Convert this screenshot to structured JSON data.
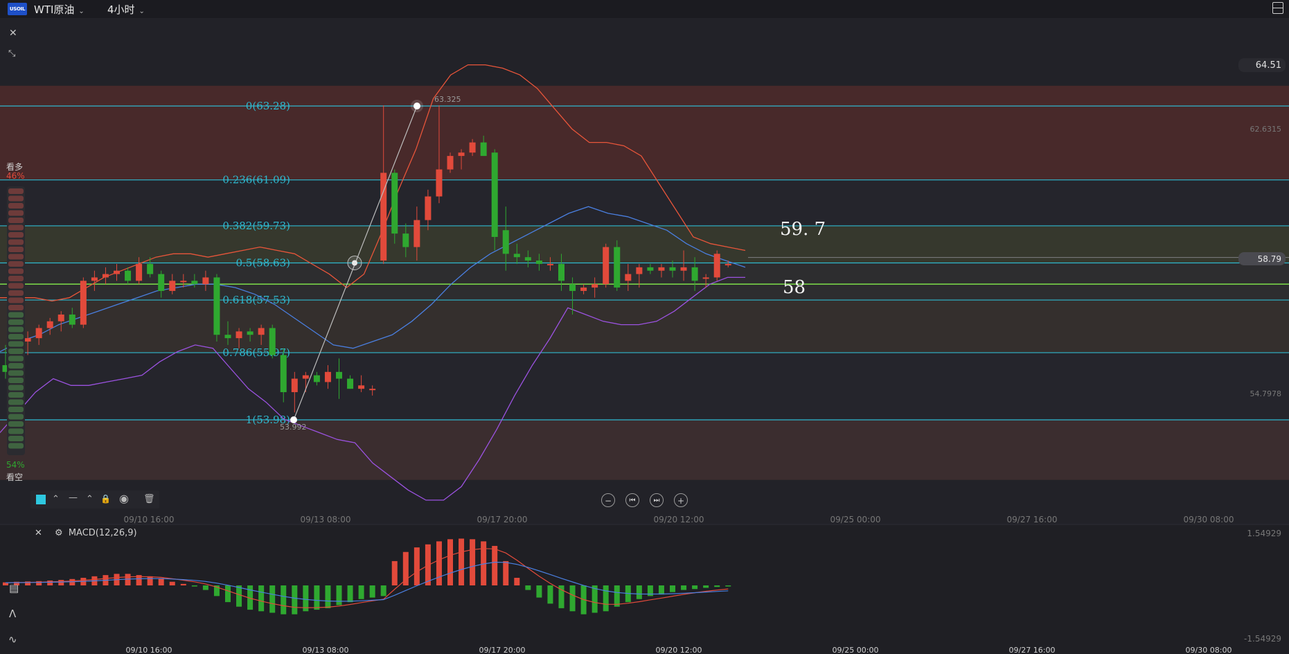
{
  "header": {
    "logo_text": "USOIL",
    "symbol_label": "WTI原油",
    "timeframe_label": "4小时",
    "chevron_icon": "chevron-down-icon",
    "layout_icon": "layout-panel-icon"
  },
  "left_tools": {
    "close_icon": "close-icon",
    "collapse_icon": "collapse-arrows-icon"
  },
  "sentiment": {
    "bull_label": "看多",
    "bull_pct": "46%",
    "bear_label": "看空",
    "bear_pct": "54%",
    "bull_fraction": 0.46
  },
  "price_axis": {
    "top": "64.51",
    "level_1": "62.6315",
    "level_2": "54.7978",
    "current": "58.79"
  },
  "fib": {
    "levels": [
      "0(63.28)",
      "0.236(61.09)",
      "0.382(59.73)",
      "0.5(58.63)",
      "0.618(57.53)",
      "0.786(55.97)",
      "1(53.98)"
    ],
    "high_label": "63.325",
    "low_label": "53.992"
  },
  "annotations": {
    "label_a": "59. 7",
    "label_b": "58"
  },
  "x_axis": {
    "ticks": [
      "09/10 16:00",
      "09/13 08:00",
      "09/17 20:00",
      "09/20 12:00",
      "09/25 00:00",
      "09/27 16:00",
      "09/30 08:00"
    ]
  },
  "drawing_toolbox": {
    "color": "#2ec8e0",
    "icons": [
      "color-swatch-icon",
      "chevron-up-icon",
      "line-style-icon",
      "chevron-up-icon",
      "lock-icon",
      "eye-icon",
      "trash-icon"
    ]
  },
  "nav_buttons": {
    "zoom_out": "−",
    "prev": "⏮",
    "next": "⏭",
    "zoom_in": "+"
  },
  "macd": {
    "label": "MACD(12,26,9)",
    "axis_top": "1.54929",
    "axis_bottom": "-1.54929"
  },
  "colors": {
    "up": "#e24a3b",
    "down": "#2fa830",
    "fib_line": "#2fb9cf",
    "horizontal": "#7ee04a",
    "boll_upper": "#e8553a",
    "boll_mid": "#4a7fe0",
    "boll_lower": "#9b52e0"
  },
  "chart_data": {
    "type": "candlestick",
    "symbol": "WTI原油",
    "interval": "4小时",
    "x_ticks": [
      "09/10 16:00",
      "09/13 08:00",
      "09/17 20:00",
      "09/20 12:00",
      "09/25 00:00",
      "09/27 16:00",
      "09/30 08:00"
    ],
    "ohlc": [
      [
        55.6,
        56.2,
        55.2,
        55.4
      ],
      [
        55.6,
        56.5,
        55.1,
        56.3
      ],
      [
        56.3,
        56.6,
        55.9,
        56.4
      ],
      [
        56.4,
        56.8,
        56.2,
        56.7
      ],
      [
        56.7,
        57.0,
        56.5,
        56.9
      ],
      [
        56.9,
        57.2,
        56.6,
        57.1
      ],
      [
        57.1,
        57.3,
        56.7,
        56.8
      ],
      [
        56.8,
        58.2,
        56.7,
        58.1
      ],
      [
        58.1,
        58.4,
        57.8,
        58.2
      ],
      [
        58.2,
        58.5,
        58.0,
        58.3
      ],
      [
        58.3,
        58.6,
        58.1,
        58.4
      ],
      [
        58.4,
        58.5,
        58.0,
        58.1
      ],
      [
        58.1,
        58.8,
        58.0,
        58.6
      ],
      [
        58.6,
        58.8,
        58.2,
        58.3
      ],
      [
        58.3,
        58.4,
        57.6,
        57.8
      ],
      [
        57.8,
        58.3,
        57.7,
        58.1
      ],
      [
        58.1,
        58.3,
        57.9,
        58.1
      ],
      [
        58.1,
        58.3,
        57.9,
        58.0
      ],
      [
        58.0,
        58.4,
        57.8,
        58.2
      ],
      [
        58.2,
        58.3,
        56.3,
        56.5
      ],
      [
        56.5,
        56.9,
        56.2,
        56.4
      ],
      [
        56.4,
        56.7,
        56.1,
        56.6
      ],
      [
        56.6,
        56.7,
        56.3,
        56.5
      ],
      [
        56.5,
        56.8,
        56.2,
        56.7
      ],
      [
        56.7,
        56.8,
        55.8,
        55.9
      ],
      [
        55.9,
        56.1,
        54.5,
        54.8
      ],
      [
        54.8,
        55.4,
        54.2,
        55.2
      ],
      [
        55.2,
        55.4,
        54.8,
        55.3
      ],
      [
        55.3,
        55.4,
        55.0,
        55.1
      ],
      [
        55.1,
        55.6,
        54.9,
        55.4
      ],
      [
        55.4,
        55.8,
        54.6,
        55.2
      ],
      [
        55.2,
        55.3,
        54.9,
        54.9
      ],
      [
        54.9,
        55.3,
        54.8,
        55.0
      ],
      [
        54.9,
        55.0,
        54.7,
        54.9
      ],
      [
        58.7,
        63.3,
        58.6,
        61.3
      ],
      [
        61.3,
        61.4,
        59.2,
        59.5
      ],
      [
        59.5,
        59.8,
        58.8,
        59.1
      ],
      [
        59.1,
        60.3,
        58.7,
        59.9
      ],
      [
        59.9,
        60.8,
        59.6,
        60.6
      ],
      [
        60.6,
        63.3,
        60.4,
        61.4
      ],
      [
        61.4,
        61.9,
        61.3,
        61.8
      ],
      [
        61.8,
        62.0,
        61.4,
        61.9
      ],
      [
        61.9,
        62.3,
        61.8,
        62.2
      ],
      [
        62.2,
        62.4,
        61.8,
        61.8
      ],
      [
        61.9,
        62.0,
        59.0,
        59.4
      ],
      [
        59.6,
        60.3,
        58.4,
        58.9
      ],
      [
        58.9,
        59.2,
        58.6,
        58.8
      ],
      [
        58.8,
        59.0,
        58.5,
        58.7
      ],
      [
        58.7,
        58.9,
        58.4,
        58.6
      ],
      [
        58.6,
        58.8,
        58.4,
        58.6
      ],
      [
        58.6,
        58.9,
        57.8,
        58.1
      ],
      [
        58.0,
        58.2,
        57.1,
        57.8
      ],
      [
        57.8,
        58.0,
        57.7,
        57.9
      ],
      [
        57.9,
        58.2,
        57.6,
        58.0
      ],
      [
        58.0,
        59.2,
        57.9,
        59.1
      ],
      [
        59.1,
        59.3,
        57.8,
        57.9
      ],
      [
        58.1,
        58.6,
        57.8,
        58.3
      ],
      [
        58.3,
        58.6,
        57.9,
        58.5
      ],
      [
        58.5,
        58.6,
        58.3,
        58.4
      ],
      [
        58.4,
        58.6,
        58.2,
        58.5
      ],
      [
        58.5,
        58.7,
        58.2,
        58.4
      ],
      [
        58.4,
        59.0,
        58.1,
        58.5
      ],
      [
        58.5,
        58.8,
        57.8,
        58.1
      ],
      [
        58.2,
        58.3,
        57.9,
        58.2
      ],
      [
        58.2,
        59.0,
        58.1,
        58.9
      ],
      [
        58.6,
        58.7,
        58.5,
        58.6
      ]
    ],
    "bollinger": {
      "upper": [
        57.6,
        57.6,
        57.6,
        57.5,
        57.6,
        57.9,
        58.2,
        58.4,
        58.6,
        58.8,
        58.9,
        58.9,
        58.8,
        58.9,
        59.0,
        59.1,
        59.0,
        58.9,
        58.6,
        58.3,
        57.9,
        58.3,
        59.5,
        60.8,
        62.0,
        63.5,
        64.2,
        64.5,
        64.5,
        64.4,
        64.2,
        63.8,
        63.2,
        62.6,
        62.2,
        62.2,
        62.1,
        61.8,
        61.0,
        60.2,
        59.4,
        59.2,
        59.1,
        59.0
      ],
      "middle": [
        56.0,
        56.3,
        56.5,
        56.8,
        57.0,
        57.2,
        57.4,
        57.6,
        57.8,
        57.9,
        58.0,
        58.0,
        57.9,
        57.7,
        57.4,
        57.0,
        56.6,
        56.2,
        56.1,
        56.3,
        56.5,
        56.9,
        57.4,
        58.0,
        58.5,
        58.9,
        59.2,
        59.5,
        59.8,
        60.1,
        60.3,
        60.1,
        60.0,
        59.8,
        59.6,
        59.2,
        58.9,
        58.7,
        58.5
      ],
      "lower": [
        53.6,
        54.2,
        54.8,
        55.2,
        55.0,
        55.0,
        55.1,
        55.2,
        55.3,
        55.7,
        56.0,
        56.2,
        56.1,
        55.5,
        54.9,
        54.5,
        54.0,
        53.8,
        53.6,
        53.4,
        53.3,
        52.7,
        52.3,
        51.9,
        51.6,
        51.6,
        52.0,
        52.8,
        53.7,
        54.7,
        55.6,
        56.4,
        57.3,
        57.1,
        56.9,
        56.8,
        56.8,
        56.9,
        57.2,
        57.6,
        58.0,
        58.2,
        58.2
      ]
    },
    "macd_hist": [
      0.1,
      0.12,
      0.13,
      0.14,
      0.16,
      0.18,
      0.21,
      0.25,
      0.3,
      0.34,
      0.38,
      0.38,
      0.34,
      0.3,
      0.24,
      0.12,
      0.05,
      -0.02,
      -0.15,
      -0.35,
      -0.55,
      -0.7,
      -0.8,
      -0.85,
      -0.9,
      -0.95,
      -0.95,
      -0.85,
      -0.8,
      -0.75,
      -0.65,
      -0.55,
      -0.45,
      -0.4,
      -0.35,
      0.8,
      1.1,
      1.25,
      1.35,
      1.45,
      1.52,
      1.54,
      1.52,
      1.45,
      1.3,
      0.8,
      0.25,
      -0.15,
      -0.4,
      -0.6,
      -0.75,
      -0.85,
      -0.95,
      -0.9,
      -0.85,
      -0.7,
      -0.55,
      -0.45,
      -0.35,
      -0.3,
      -0.22,
      -0.15,
      -0.12,
      -0.08,
      -0.05,
      -0.03
    ]
  }
}
